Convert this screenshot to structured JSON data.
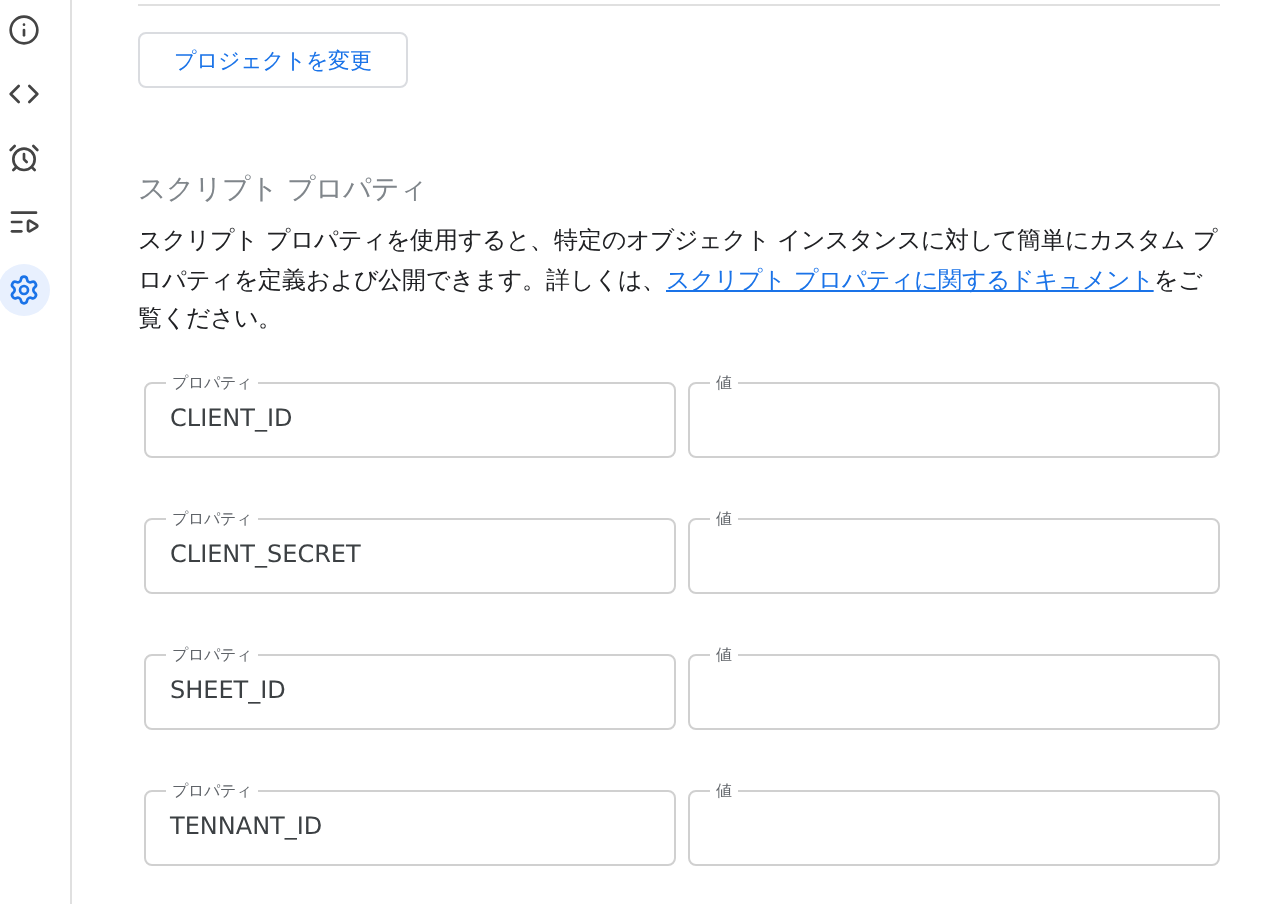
{
  "sidebar": {
    "items": [
      {
        "kind": "info",
        "selected": false
      },
      {
        "kind": "code",
        "selected": false
      },
      {
        "kind": "alarm",
        "selected": false
      },
      {
        "kind": "executions",
        "selected": false
      },
      {
        "kind": "settings",
        "selected": true
      }
    ]
  },
  "change_project_button": "プロジェクトを変更",
  "script_properties": {
    "heading": "スクリプト プロパティ",
    "description": "スクリプト プロパティを使用すると、特定のオブジェクト インスタンスに対して簡単にカスタム プロパティを定義および公開できます。詳しくは、",
    "link": "スクリプト プロパティに関するドキュメント",
    "description_end": "をご覧ください。",
    "rows": [
      {
        "property": {
          "label": "プロパティ",
          "value": "CLIENT_ID"
        },
        "value": {
          "label": "値"
        }
      },
      {
        "property": {
          "label": "プロパティ",
          "value": "CLIENT_SECRET"
        },
        "value": {
          "label": "値"
        }
      },
      {
        "property": {
          "label": "プロパティ",
          "value": "SHEET_ID"
        },
        "value": {
          "label": "値"
        }
      },
      {
        "property": {
          "label": "プロパティ",
          "value": "TENNANT_ID"
        },
        "value": {
          "label": "値"
        }
      }
    ]
  }
}
